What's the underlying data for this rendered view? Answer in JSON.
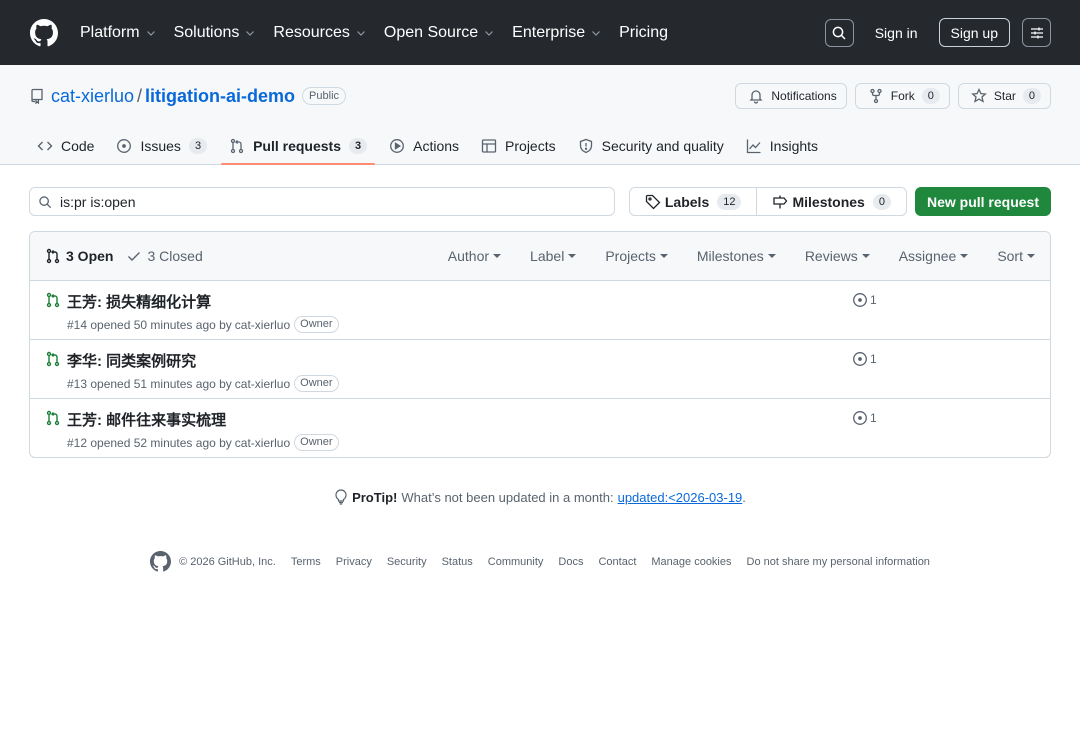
{
  "header": {
    "nav": [
      {
        "label": "Platform"
      },
      {
        "label": "Solutions"
      },
      {
        "label": "Resources"
      },
      {
        "label": "Open Source"
      },
      {
        "label": "Enterprise"
      },
      {
        "label": "Pricing"
      }
    ],
    "sign_in": "Sign in",
    "sign_up": "Sign up"
  },
  "repo": {
    "owner": "cat-xierluo",
    "separator": "/",
    "name": "litigation-ai-demo",
    "visibility": "Public",
    "notifications_label": "Notifications",
    "fork_label": "Fork",
    "fork_count": "0",
    "star_label": "Star",
    "star_count": "0"
  },
  "tabs": {
    "code": "Code",
    "issues": "Issues",
    "issues_count": "3",
    "pulls": "Pull requests",
    "pulls_count": "3",
    "actions": "Actions",
    "projects": "Projects",
    "security": "Security and quality",
    "insights": "Insights"
  },
  "subnav": {
    "filter_value": "is:pr is:open",
    "labels_label": "Labels",
    "labels_count": "12",
    "milestones_label": "Milestones",
    "milestones_count": "0",
    "new_pr_label": "New pull request"
  },
  "list": {
    "open_label": "3 Open",
    "closed_label": "3 Closed",
    "filters": [
      "Author",
      "Label",
      "Projects",
      "Milestones",
      "Reviews",
      "Assignee",
      "Sort"
    ],
    "prs": [
      {
        "title": "王芳: 损失精细化计算",
        "meta": "#14 opened 50 minutes ago by",
        "author": "cat-xierluo",
        "badge": "Owner",
        "checks": "1"
      },
      {
        "title": "李华: 同类案例研究",
        "meta": "#13 opened 51 minutes ago by",
        "author": "cat-xierluo",
        "badge": "Owner",
        "checks": "1"
      },
      {
        "title": "王芳: 邮件往来事实梳理",
        "meta": "#12 opened 52 minutes ago by",
        "author": "cat-xierluo",
        "badge": "Owner",
        "checks": "1"
      }
    ]
  },
  "protip": {
    "label": "ProTip!",
    "text": "What’s not been updated in a month:",
    "link": "updated:<2026-03-19",
    "suffix": "."
  },
  "footer": {
    "copyright": "© 2026 GitHub, Inc.",
    "links": [
      "Terms",
      "Privacy",
      "Security",
      "Status",
      "Community",
      "Docs",
      "Contact",
      "Manage cookies",
      "Do not share my personal information"
    ]
  },
  "colors": {
    "header_bg": "#25292e",
    "link_blue": "#0969da",
    "primary_green": "#1f883d",
    "open_pr_green": "#1a7f37",
    "active_tab_underline": "#fd8c73"
  }
}
